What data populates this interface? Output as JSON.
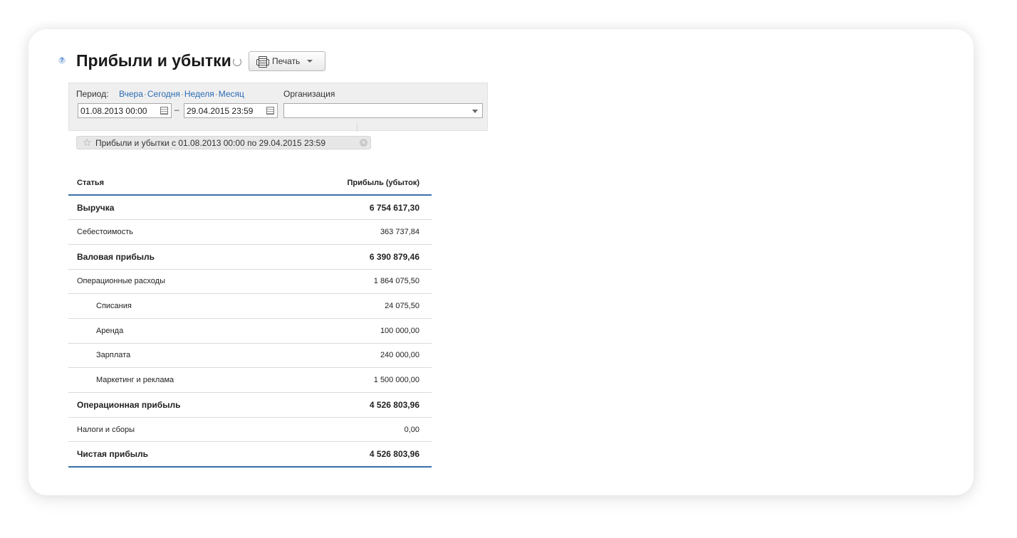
{
  "title": "Прибыли и убытки",
  "help_glyph": "?",
  "print_button_label": "Печать",
  "filter": {
    "period_label": "Период:",
    "period_links": [
      "Вчера",
      "Сегодня",
      "Неделя",
      "Месяц"
    ],
    "date_from": "01.08.2013 00:00",
    "date_to": "29.04.2015 23:59",
    "dash": "–",
    "org_label": "Организация",
    "org_value": ""
  },
  "chip": {
    "text": "Прибыли и убытки с 01.08.2013 00:00 по 29.04.2015 23:59",
    "close": "×"
  },
  "table": {
    "columns": [
      "Статья",
      "Прибыль (убыток)"
    ],
    "rows": [
      {
        "label": "Выручка",
        "value": "6 754 617,30",
        "style": "bold"
      },
      {
        "label": "Себестоимость",
        "value": "363 737,84",
        "style": "normal"
      },
      {
        "label": "Валовая прибыль",
        "value": "6 390 879,46",
        "style": "bold"
      },
      {
        "label": "Операционные расходы",
        "value": "1 864 075,50",
        "style": "normal"
      },
      {
        "label": "Списания",
        "value": "24 075,50",
        "style": "indent"
      },
      {
        "label": "Аренда",
        "value": "100 000,00",
        "style": "indent"
      },
      {
        "label": "Зарплата",
        "value": "240 000,00",
        "style": "indent"
      },
      {
        "label": "Маркетинг и реклама",
        "value": "1 500 000,00",
        "style": "indent"
      },
      {
        "label": "Операционная прибыль",
        "value": "4 526 803,96",
        "style": "bold"
      },
      {
        "label": "Налоги и сборы",
        "value": "0,00",
        "style": "normal"
      },
      {
        "label": "Чистая прибыль",
        "value": "4 526 803,96",
        "style": "bold"
      }
    ]
  }
}
